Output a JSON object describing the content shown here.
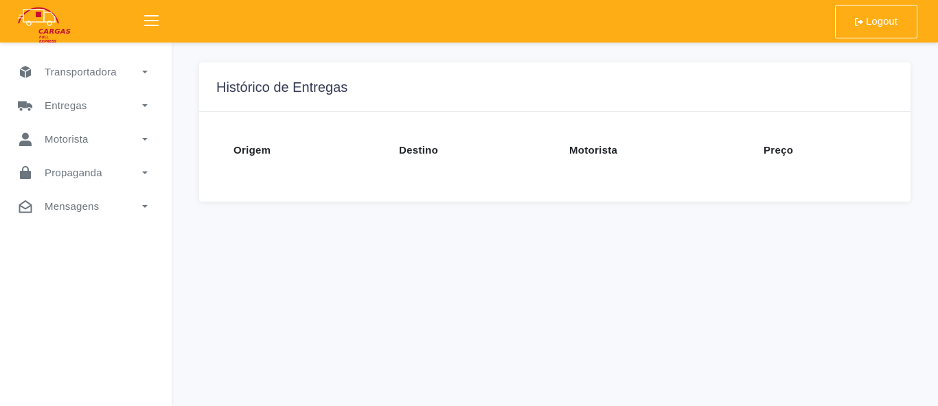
{
  "brand": {
    "logo_text": "CARGAS",
    "logo_subtext": "FULL EXPRESS",
    "accent": "#ffad14",
    "logo_red": "#c8102e"
  },
  "topbar": {
    "menu_icon": "hamburger-icon",
    "logout_label": "Logout",
    "logout_icon": "sign-out-icon"
  },
  "sidebar": {
    "items": [
      {
        "label": "Transportadora",
        "icon": "cube-icon"
      },
      {
        "label": "Entregas",
        "icon": "truck-icon"
      },
      {
        "label": "Motorista",
        "icon": "user-icon"
      },
      {
        "label": "Propaganda",
        "icon": "shopping-bag-icon"
      },
      {
        "label": "Mensagens",
        "icon": "envelope-open-icon"
      }
    ]
  },
  "main": {
    "card_title": "Histórico de Entregas",
    "table": {
      "headers": [
        "Origem",
        "Destino",
        "Motorista",
        "Preço"
      ]
    }
  }
}
